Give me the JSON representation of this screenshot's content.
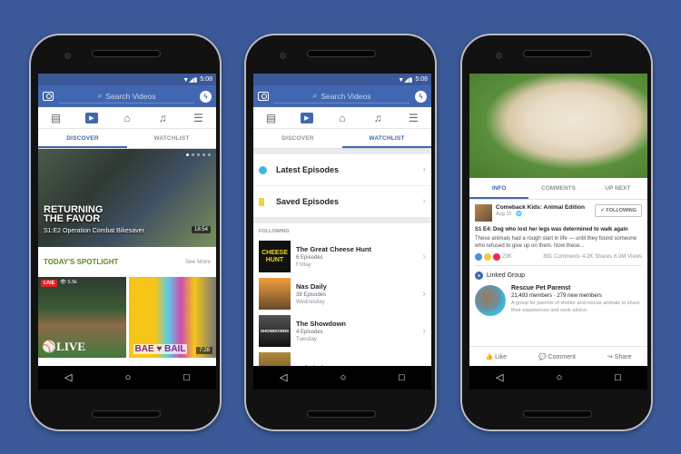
{
  "status": {
    "time": "5:08"
  },
  "search": {
    "placeholder": "Search Videos"
  },
  "nav": {
    "back": "◁",
    "home": "○",
    "recent": "□"
  },
  "icons": {
    "feed": "▤",
    "watch": "▶",
    "marketplace": "⌂",
    "notifications": "🔔",
    "menu": "☰"
  },
  "tabs": {
    "discover": "DISCOVER",
    "watchlist": "WATCHLIST"
  },
  "phone1": {
    "hero": {
      "title_line1": "RETURNING",
      "title_line2": "THE FAVOR",
      "episode": "S1:E2 Operation Combat Bikesaver",
      "duration": "18:54"
    },
    "spotlight": {
      "heading": "TODAY'S SPOTLIGHT",
      "see_more": "See More"
    },
    "thumbs": [
      {
        "badge": "LIVE",
        "views": "👁 5.5k",
        "label": "⚾LIVE"
      },
      {
        "label": "BAE ♥ BAIL",
        "duration": "7:28"
      }
    ]
  },
  "phone2": {
    "rows": [
      {
        "label": "Latest Episodes",
        "icon": "play-circle-icon",
        "color": "#3fb8e8"
      },
      {
        "label": "Saved Episodes",
        "icon": "bookmark-icon",
        "color": "#f7d14c"
      }
    ],
    "following_heading": "FOLLOWING",
    "following": [
      {
        "name": "The Great Cheese Hunt",
        "count": "6 Episodes",
        "day": "Friday",
        "art": "CHEESE HUNT"
      },
      {
        "name": "Nas Daily",
        "count": "38 Episodes",
        "day": "Wednesday",
        "art": ""
      },
      {
        "name": "The Showdown",
        "count": "4 Episodes",
        "day": "Tuesday",
        "art": "SHOWDOWNS"
      },
      {
        "name": "Safari Live",
        "count": "",
        "day": "",
        "art": ""
      }
    ]
  },
  "phone3": {
    "tabs": [
      "INFO",
      "COMMENTS",
      "UP NEXT"
    ],
    "post": {
      "page": "Comeback Kids: Animal Edition",
      "date": "Aug 10 · 🌐",
      "follow_label": "✓ FOLLOWING",
      "title": "S1 E4: Dog who lost her legs was determined to walk again",
      "body": "These animals had a rough start in life — until they found someone who refused to give up on them. Now these...",
      "reactions": "23K",
      "comments": "881 Comments",
      "shares": "4.2K Shares",
      "views": "6.3M Views"
    },
    "linked_group": {
      "heading": "Linked Group",
      "name": "Rescue Pet Parenst",
      "members": "21,493 members · 279 new members",
      "description": "A group for parents of shelter and rescue animals to share their experiences and seek advice."
    },
    "actions": {
      "like": "👍 Like",
      "comment": "💬 Comment",
      "share": "↪ Share"
    }
  }
}
